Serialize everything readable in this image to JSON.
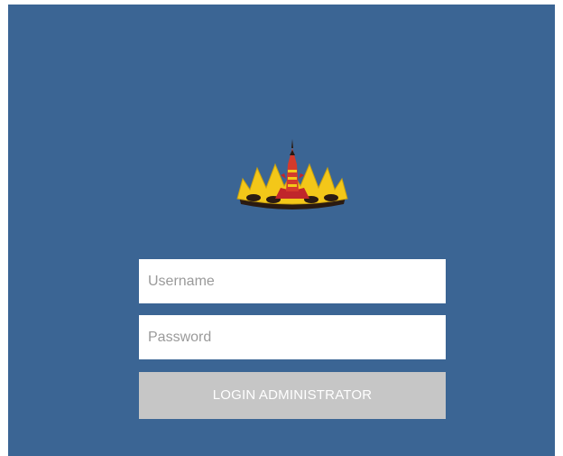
{
  "login": {
    "logo_icon": "crown-emblem-icon",
    "username_placeholder": "Username",
    "username_value": "",
    "password_placeholder": "Password",
    "password_value": "",
    "login_label": "LOGIN ADMINISTRATOR"
  },
  "colors": {
    "background": "#3b6594",
    "field": "#ffffff",
    "button": "#c6c6c6",
    "button_text": "#ffffff",
    "crown_gold": "#f3c719",
    "crown_red": "#c0262b"
  }
}
